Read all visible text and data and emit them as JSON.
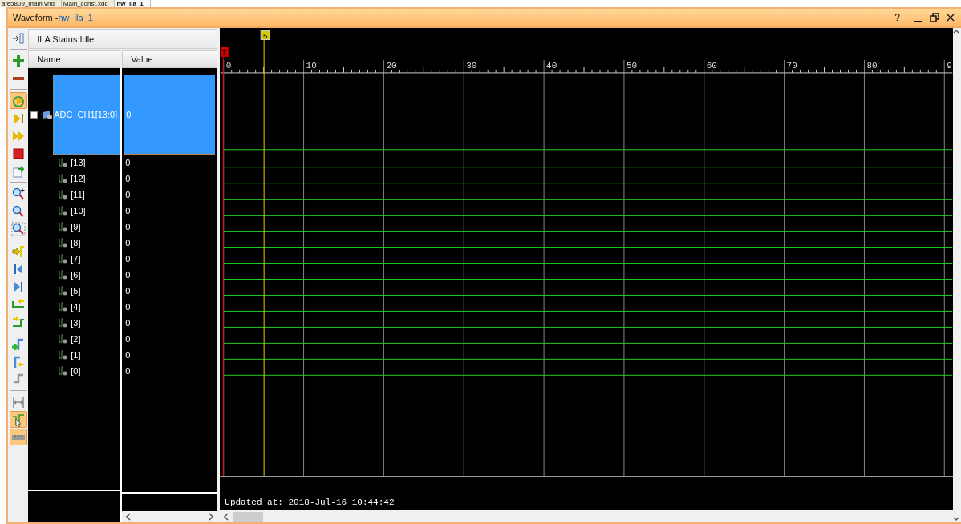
{
  "editor_tabs": [
    {
      "label": "afe5809_main.vhd",
      "selected": false
    },
    {
      "label": "Main_const.xdc",
      "selected": false
    },
    {
      "label": "hw_ila_1",
      "selected": true
    }
  ],
  "window": {
    "title": "Waveform - ",
    "title_link": "hw_ila_1",
    "help_label": "?"
  },
  "toolbar": [
    {
      "kind": "collapse",
      "pressed": false
    },
    {
      "kind": "separator"
    },
    {
      "kind": "add",
      "pressed": false
    },
    {
      "kind": "remove",
      "pressed": false
    },
    {
      "kind": "separator"
    },
    {
      "kind": "run-trigger",
      "pressed": true
    },
    {
      "kind": "run",
      "pressed": false
    },
    {
      "kind": "run-immediate",
      "pressed": false
    },
    {
      "kind": "stop",
      "pressed": false
    },
    {
      "kind": "export",
      "pressed": false
    },
    {
      "kind": "separator"
    },
    {
      "kind": "zoom-in",
      "pressed": false
    },
    {
      "kind": "zoom-out",
      "pressed": false
    },
    {
      "kind": "zoom-fit",
      "pressed": false
    },
    {
      "kind": "separator"
    },
    {
      "kind": "go-cursor",
      "pressed": false
    },
    {
      "kind": "go-start",
      "pressed": false
    },
    {
      "kind": "go-end",
      "pressed": false
    },
    {
      "kind": "prev-edge",
      "pressed": false
    },
    {
      "kind": "next-edge",
      "pressed": false
    },
    {
      "kind": "separator"
    },
    {
      "kind": "add-marker",
      "pressed": false
    },
    {
      "kind": "prev-marker",
      "pressed": false
    },
    {
      "kind": "next-marker",
      "pressed": false
    },
    {
      "kind": "separator"
    },
    {
      "kind": "swap",
      "pressed": false
    },
    {
      "kind": "snap",
      "pressed": true
    },
    {
      "kind": "ruler",
      "pressed": true
    }
  ],
  "status": "ILA Status:Idle",
  "columns": [
    "Name",
    "Value"
  ],
  "signal": {
    "name": "ADC_CH1[13:0]",
    "value": "0",
    "expanded": true,
    "selected": true,
    "children": [
      {
        "name": "[13]",
        "value": "0"
      },
      {
        "name": "[12]",
        "value": "0"
      },
      {
        "name": "[11]",
        "value": "0"
      },
      {
        "name": "[10]",
        "value": "0"
      },
      {
        "name": "[9]",
        "value": "0"
      },
      {
        "name": "[8]",
        "value": "0"
      },
      {
        "name": "[7]",
        "value": "0"
      },
      {
        "name": "[6]",
        "value": "0"
      },
      {
        "name": "[5]",
        "value": "0"
      },
      {
        "name": "[4]",
        "value": "0"
      },
      {
        "name": "[3]",
        "value": "0"
      },
      {
        "name": "[2]",
        "value": "0"
      },
      {
        "name": "[1]",
        "value": "0"
      },
      {
        "name": "[0]",
        "value": "0"
      }
    ]
  },
  "ruler_labels": [
    "0",
    "10",
    "20",
    "30",
    "40",
    "50",
    "60",
    "70",
    "80",
    "9"
  ],
  "cursor_label": "5",
  "trigger_label": "T",
  "updated": "Updated at: 2018-Jul-16 10:44:42"
}
